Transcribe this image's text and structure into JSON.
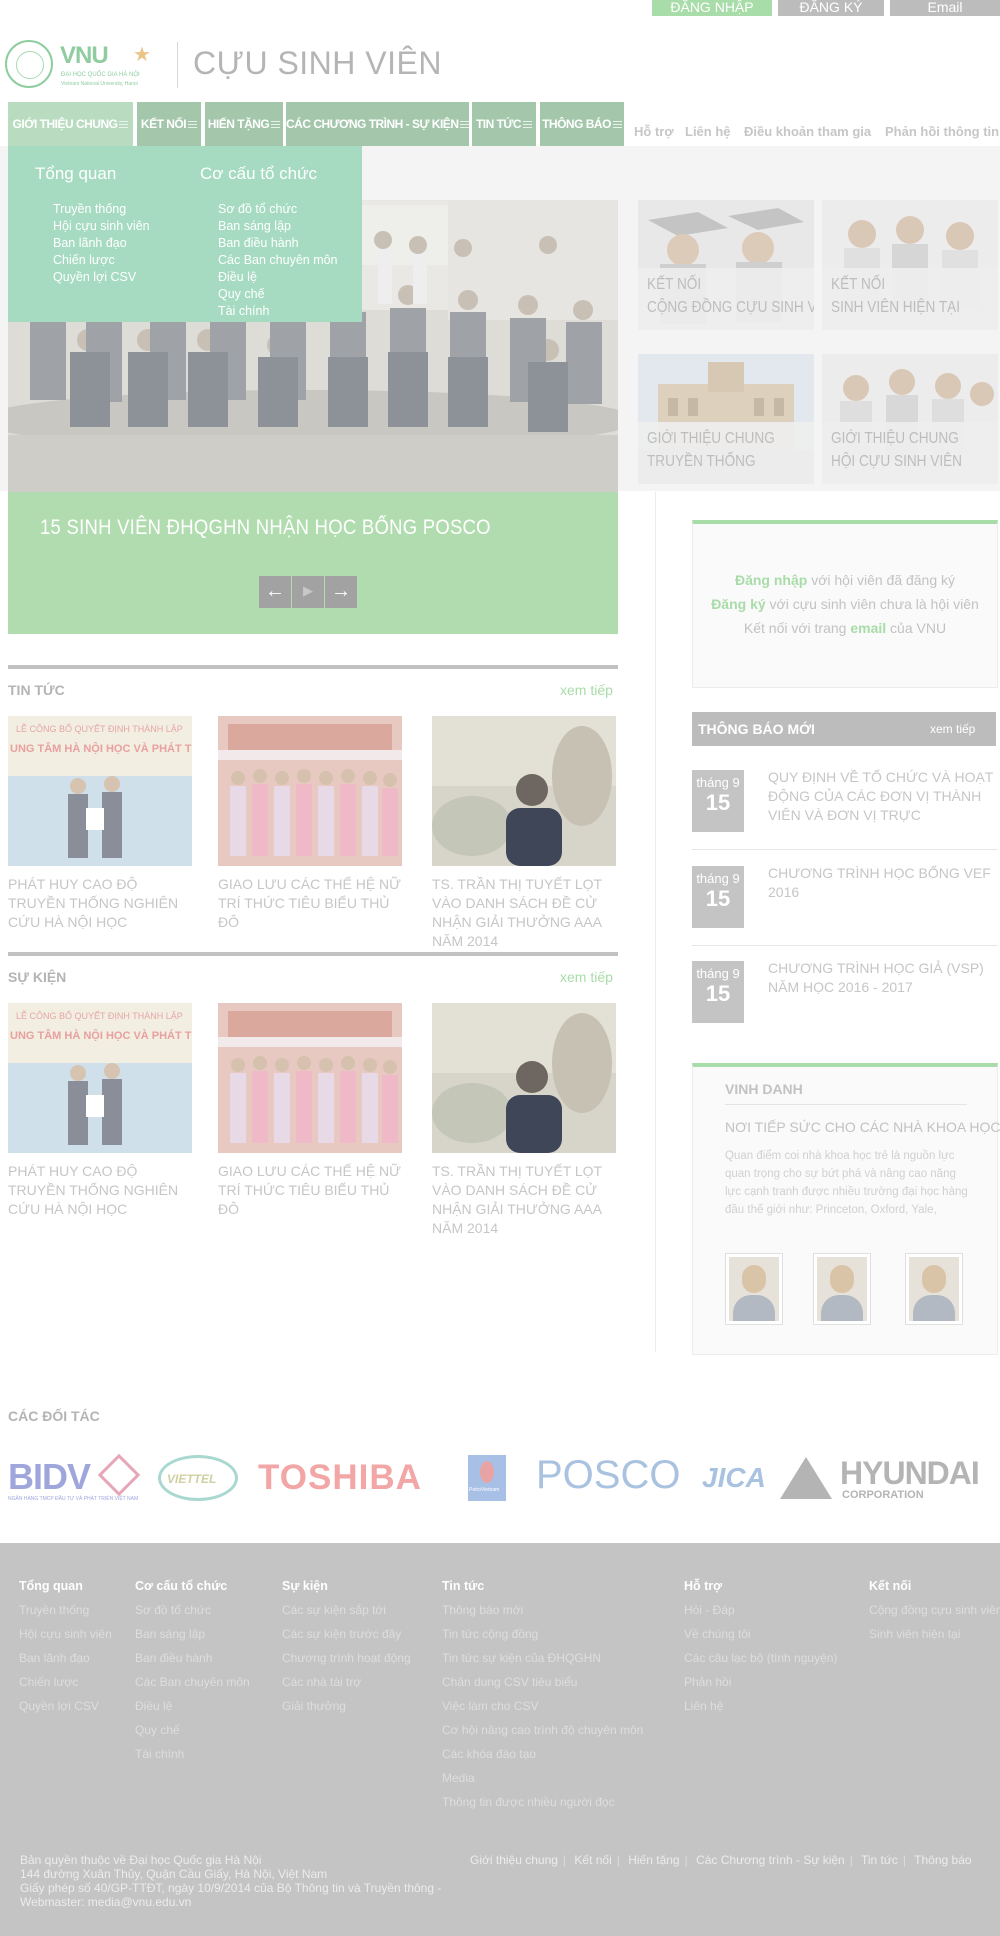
{
  "topbar": {
    "login": "ĐĂNG NHẬP",
    "register": "ĐĂNG KÝ",
    "email": "Email"
  },
  "header": {
    "logo_text": "VNU",
    "logo_sub": "ĐẠI HỌC QUỐC GIA HÀ NỘI",
    "logo_sub_en": "Vietnam National University, Hanoi",
    "site_title": "CỰU SINH VIÊN"
  },
  "nav": {
    "items": [
      "GIỚI THIỆU CHUNG",
      "KẾT NỐI",
      "HIẾN TẶNG",
      "CÁC CHƯƠNG TRÌNH - SỰ KIỆN",
      "TIN TỨC",
      "THÔNG BÁO"
    ],
    "links": [
      "Hỗ trợ",
      "Liên hệ",
      "Điều khoản tham gia",
      "Phản hồi thông tin"
    ]
  },
  "dropdown": {
    "col1_title": "Tổng quan",
    "col1": [
      "Truyền thống",
      "Hội cựu sinh viên",
      "Ban lãnh đạo",
      "Chiến lược",
      "Quyền lợi CSV"
    ],
    "col2_title": "Cơ cấu tổ chức",
    "col2": [
      "Sơ đồ tổ chức",
      "Ban sáng lập",
      "Ban điều hành",
      "Các Ban chuyên môn",
      "Điều lệ",
      "Quy chế",
      "Tài chính"
    ]
  },
  "hero": {
    "caption": "15 SINH VIÊN ĐHQGHN NHẬN HỌC BỔNG POSCO",
    "prev": "←",
    "play": "▶",
    "next": "→"
  },
  "tiles": [
    {
      "l1": "KẾT NỐI",
      "l2": "CỘNG ĐỒNG CỰU SINH VIÊN"
    },
    {
      "l1": "KẾT NỐI",
      "l2": "SINH VIÊN HIỆN TẠI"
    },
    {
      "l1": "GIỚI THIỆU CHUNG",
      "l2": "TRUYỀN THỐNG"
    },
    {
      "l1": "GIỚI THIỆU CHUNG",
      "l2": "HỘI CỰU SINH VIÊN"
    }
  ],
  "login_box": {
    "l1_bold": "Đăng nhập",
    "l1_rest": " với hội viên đã đăng ký",
    "l2_bold": "Đăng ký",
    "l2_rest": " với cựu sinh viên chưa là hội viên",
    "l3_pre": "Kết nối với trang ",
    "l3_bold": "email",
    "l3_rest": " của VNU"
  },
  "news": {
    "title": "TIN TỨC",
    "more": "xem tiếp",
    "items": [
      "PHÁT HUY CAO ĐỘ TRUYỀN THỐNG NGHIÊN CỨU HÀ NỘI HỌC",
      "GIAO LƯU CÁC THẾ HỆ NỮ TRÍ THỨC TIÊU BIỂU THỦ ĐÔ",
      "TS. TRẦN THỊ TUYẾT LỌT VÀO DANH SÁCH ĐỀ CỬ NHẬN GIẢI THƯỞNG AAA NĂM 2014"
    ]
  },
  "events": {
    "title": "SỰ KIỆN",
    "more": "xem tiếp",
    "items": [
      "PHÁT HUY CAO ĐỘ TRUYỀN THỐNG NGHIÊN CỨU HÀ NỘI HỌC",
      "GIAO LƯU CÁC THẾ HỆ NỮ TRÍ THỨC TIÊU BIỂU THỦ ĐÔ",
      "TS. TRẦN THỊ TUYẾT LỌT VÀO DANH SÁCH ĐỀ CỬ NHẬN GIẢI THƯỞNG AAA NĂM 2014"
    ]
  },
  "banner_text": {
    "line1": "LỄ CÔNG BỐ QUYẾT ĐỊNH THÀNH LẬP",
    "line2": "UNG TÂM HÀ NỘI HỌC VÀ PHÁT TRIỂN TH"
  },
  "notices": {
    "title": "THÔNG BÁO MỚI",
    "more": "xem tiếp",
    "items": [
      {
        "month": "tháng 9",
        "day": "15",
        "text": "QUY ĐỊNH VỀ TỔ CHỨC VÀ HOẠT ĐỘNG CỦA CÁC ĐƠN VỊ THÀNH VIÊN VÀ ĐƠN VỊ TRỰC"
      },
      {
        "month": "tháng 9",
        "day": "15",
        "text": "CHƯƠNG TRÌNH HỌC BỔNG VEF 2016"
      },
      {
        "month": "tháng 9",
        "day": "15",
        "text": "CHƯƠNG TRÌNH HỌC GIẢ (VSP) NĂM HỌC 2016 - 2017"
      }
    ]
  },
  "honor": {
    "title": "VINH DANH",
    "subtitle": "NƠI TIẾP SỨC CHO CÁC NHÀ KHOA HỌC TRẺ",
    "text": "Quan điểm coi nhà khoa học trẻ là nguồn lực quan trọng cho sự bứt phá và nâng cao năng lực cạnh tranh được nhiều trường đại học hàng đầu thế giới như: Princeton, Oxford, Yale,"
  },
  "partners": {
    "title": "CÁC ĐỐI TÁC",
    "logos": [
      "BIDV",
      "VIETTEL",
      "TOSHIBA",
      "PETROVIETNAM",
      "POSCO",
      "JICA",
      "HYUNDAI"
    ],
    "bidv_sub": "NGÂN HÀNG TMCP ĐẦU TƯ VÀ PHÁT TRIỂN VIỆT NAM",
    "hyundai_sub": "CORPORATION",
    "pvn_label": "PetroVietnam",
    "colors": {
      "bidv": "#9fa6dc",
      "viettel": "#9fcfcf",
      "toshiba": "#f2a6a6",
      "posco": "#a8c2e0",
      "hyundai": "#b4b4b4"
    }
  },
  "footer": {
    "columns": [
      {
        "title": "Tổng quan",
        "items": [
          "Truyền thống",
          "Hội cựu sinh viên",
          "Ban lãnh đạo",
          "Chiến lược",
          "Quyền lợi CSV"
        ]
      },
      {
        "title": "Cơ cấu tổ chức",
        "items": [
          "Sơ đồ tổ chức",
          "Ban sáng lập",
          "Ban điều hành",
          "Các Ban chuyên môn",
          "Điều lệ",
          "Quy chế",
          "Tài chính"
        ]
      },
      {
        "title": "Sự kiện",
        "items": [
          "Các sự kiện sắp tới",
          "Các sự kiện trước đây",
          "Chương trình hoạt động",
          "Các nhà tài trợ",
          "Giải thưởng"
        ]
      },
      {
        "title": "Tin tức",
        "items": [
          "Thông báo mới",
          "Tin tức cộng đồng",
          "Tin tức sự kiện của ĐHQGHN",
          "Chân dung CSV tiêu biểu",
          "Việc làm cho CSV",
          "Cơ hội nâng cao trình độ chuyên môn",
          "Các khóa đào tạo",
          "Media",
          "Thông tin được nhiều người đọc"
        ]
      },
      {
        "title": "Hỗ trợ",
        "items": [
          "Hỏi - Đáp",
          "Về chúng tôi",
          "Các câu lạc bộ (tình nguyện)",
          "Phản hồi",
          "Liên hệ"
        ]
      },
      {
        "title": "Kết nối",
        "items": [
          "Cộng đồng cựu sinh viên",
          "Sinh viên hiện tại"
        ]
      }
    ],
    "copyright": [
      "Bản quyền thuộc về Đại học Quốc gia Hà Nội",
      "144 đường Xuân Thủy, Quận Cầu Giấy, Hà Nội, Việt Nam",
      "Giấy phép số 40/GP-TTĐT, ngày 10/9/2014 của Bộ Thông tin và Truyền thông -",
      "Webmaster: media@vnu.edu.vn"
    ],
    "links": [
      "Giới thiệu chung",
      "Kết nối",
      "Hiến tặng",
      "Các Chương trình - Sự kiện",
      "Tin tức",
      "Thông báo"
    ]
  }
}
